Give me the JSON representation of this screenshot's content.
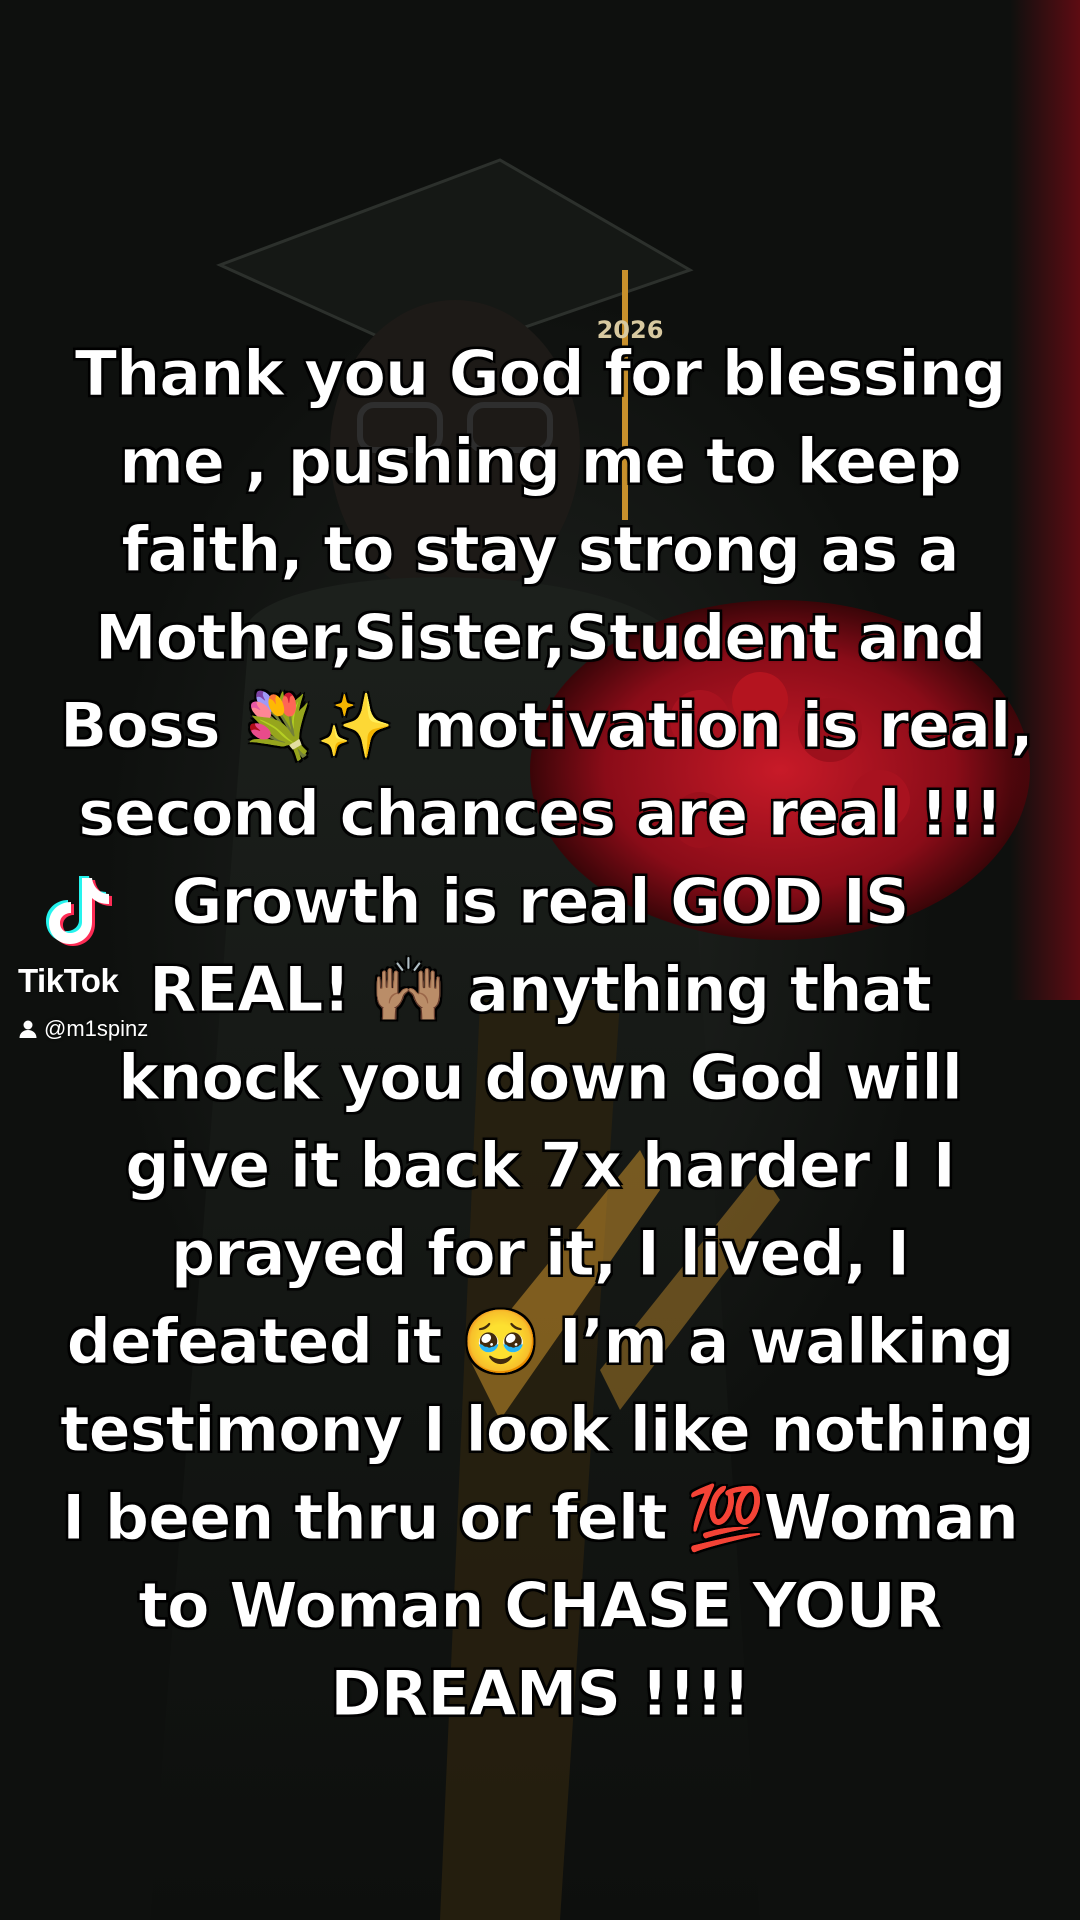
{
  "background": {
    "cap_year": "2026",
    "colors": {
      "base": "#0c0e0c",
      "accent_red": "#b01020",
      "gold": "#c8902c"
    }
  },
  "caption": {
    "lines": [
      "Thank you God for blessing",
      "me , pushing me to keep",
      "faith, to stay strong as a",
      "Mother,Sister,Student and",
      "Boss 💐✨ motivation is real,",
      "second chances are real !!!",
      "Growth is real GOD IS",
      "REAL! 🙌🏽 anything that",
      "knock you down God will",
      "give it back 7x harder I  I",
      "prayed for it, I lived, I",
      "defeated it 🥹 I’m a walking",
      "testimony I look like nothing",
      "I been thru or felt 💯Woman",
      "to Woman CHASE YOUR",
      "DREAMS !!!!"
    ]
  },
  "watermark": {
    "icon": "tiktok-logo-icon",
    "brand": "TikTok",
    "user_icon": "person-icon",
    "username": "@m1spinz"
  }
}
